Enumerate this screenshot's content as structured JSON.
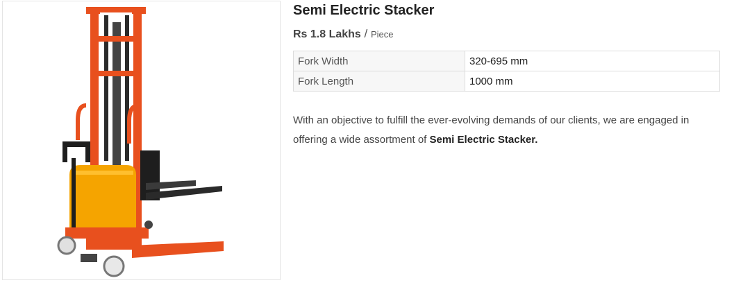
{
  "product": {
    "title": "Semi Electric Stacker",
    "price_amount": "Rs 1.8 Lakhs",
    "price_sep": " / ",
    "price_unit": "Piece",
    "image": {
      "subject": "stacker-icon"
    },
    "specs": [
      {
        "label": "Fork Width",
        "value": "320-695 mm"
      },
      {
        "label": "Fork Length",
        "value": "1000 mm"
      }
    ],
    "description_prefix": "With an objective to fulfill the ever-evolving demands of our clients, we are engaged in offering a wide assortment of ",
    "description_bold": "Semi Electric Stacker."
  },
  "colors": {
    "frame": "#e8501e",
    "body": "#f5a400",
    "dark": "#1e1e1e"
  }
}
